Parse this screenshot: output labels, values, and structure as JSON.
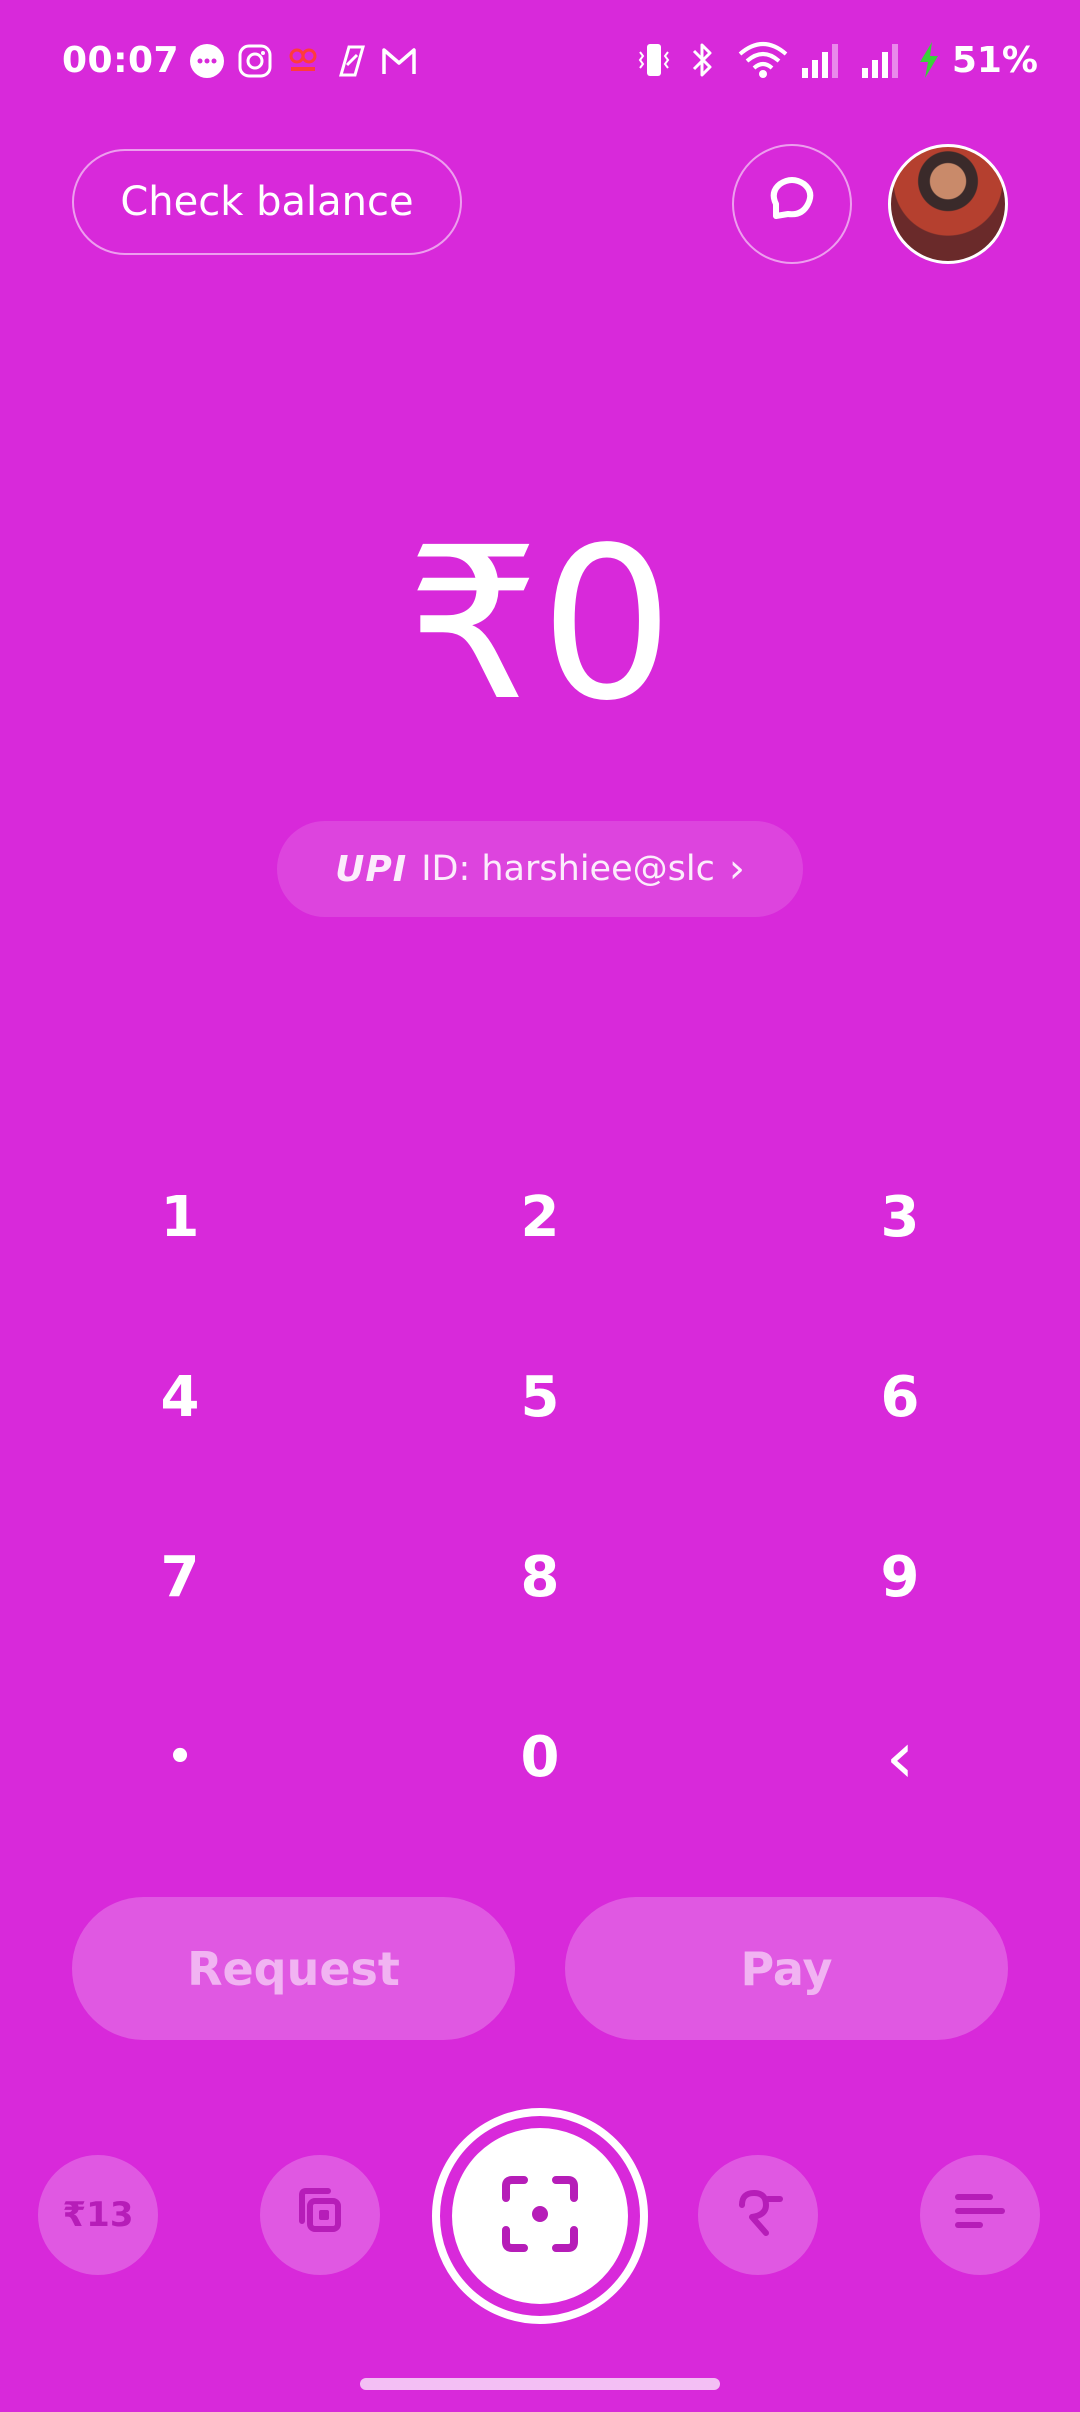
{
  "status_bar": {
    "time": "00:07",
    "battery": "51%",
    "notification_icons": [
      "messages-icon",
      "instagram-icon",
      "app-icon",
      "swiggy-icon",
      "gmail-icon"
    ]
  },
  "header": {
    "check_balance_label": "Check balance"
  },
  "amount": {
    "display": "₹0"
  },
  "upi": {
    "logo_text": "UPI",
    "id_text": "ID: harshiee@slc",
    "chevron": "›"
  },
  "keypad": {
    "keys": [
      "1",
      "2",
      "3",
      "4",
      "5",
      "6",
      "7",
      "8",
      "9",
      "•",
      "0",
      "‹"
    ]
  },
  "actions": {
    "request_label": "Request",
    "pay_label": "Pay"
  },
  "bottom_nav": {
    "rewards_label": "₹13"
  },
  "colors": {
    "background": "#D829DA",
    "nav_icon": "#B61DB8"
  }
}
